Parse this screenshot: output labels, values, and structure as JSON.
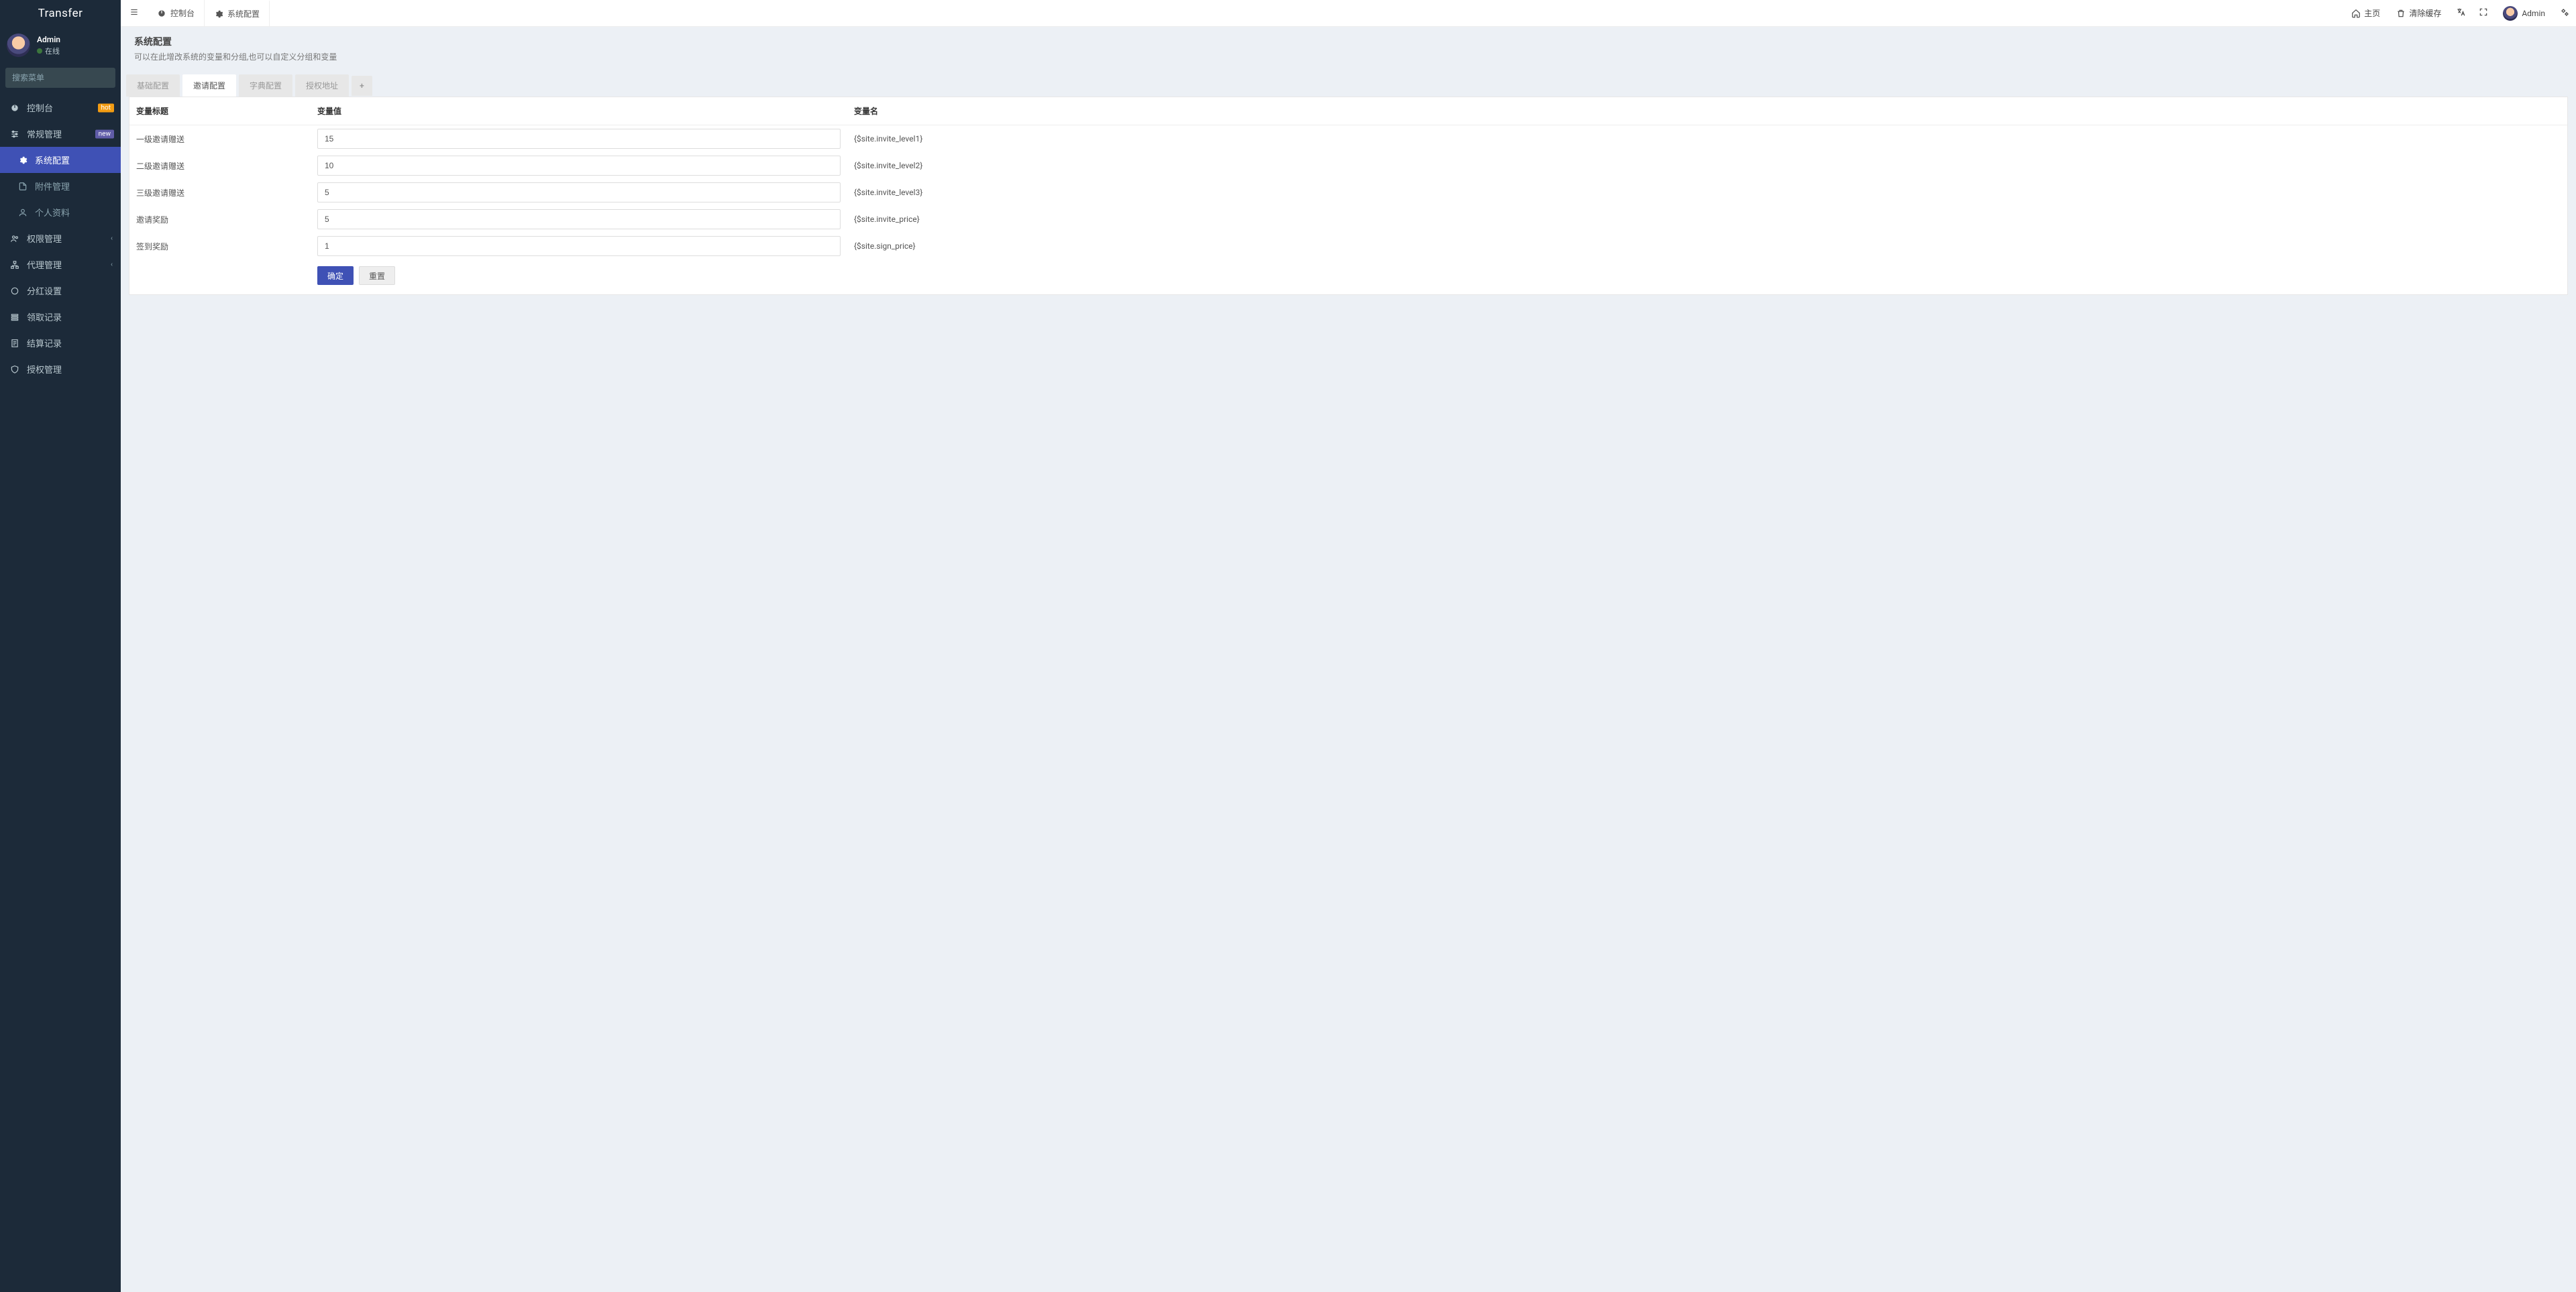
{
  "app": {
    "name": "Transfer"
  },
  "user": {
    "name": "Admin",
    "status": "在线"
  },
  "sidebar": {
    "search_placeholder": "搜索菜单",
    "items": [
      {
        "label": "控制台",
        "badge": "hot",
        "badge_class": "badge-hot"
      },
      {
        "label": "常规管理",
        "badge": "new",
        "badge_class": "badge-new"
      },
      {
        "label": "系统配置",
        "sub": true,
        "active": true
      },
      {
        "label": "附件管理",
        "sub": true,
        "muted": true
      },
      {
        "label": "个人资料",
        "sub": true,
        "muted": true
      },
      {
        "label": "权限管理",
        "caret": true
      },
      {
        "label": "代理管理",
        "caret": true
      },
      {
        "label": "分红设置"
      },
      {
        "label": "领取记录"
      },
      {
        "label": "结算记录"
      },
      {
        "label": "授权管理"
      }
    ]
  },
  "top_tabs": [
    {
      "label": "控制台"
    },
    {
      "label": "系统配置",
      "active": true
    }
  ],
  "topbar": {
    "home": "主页",
    "clear_cache": "清除缓存",
    "user": "Admin"
  },
  "page": {
    "title": "系统配置",
    "subtitle": "可以在此增改系统的变量和分组,也可以自定义分组和变量"
  },
  "config_tabs": [
    {
      "label": "基础配置"
    },
    {
      "label": "邀请配置",
      "active": true
    },
    {
      "label": "字典配置"
    },
    {
      "label": "授权地址"
    },
    {
      "label": "+",
      "add": true
    }
  ],
  "table": {
    "headers": {
      "label": "变量标题",
      "value": "变量值",
      "var": "变量名"
    },
    "rows": [
      {
        "label": "一级邀请赠送",
        "value": "15",
        "var": "{$site.invite_level1}"
      },
      {
        "label": "二级邀请赠送",
        "value": "10",
        "var": "{$site.invite_level2}"
      },
      {
        "label": "三级邀请赠送",
        "value": "5",
        "var": "{$site.invite_level3}"
      },
      {
        "label": "邀请奖励",
        "value": "5",
        "var": "{$site.invite_price}"
      },
      {
        "label": "签到奖励",
        "value": "1",
        "var": "{$site.sign_price}"
      }
    ]
  },
  "buttons": {
    "submit": "确定",
    "reset": "重置"
  }
}
